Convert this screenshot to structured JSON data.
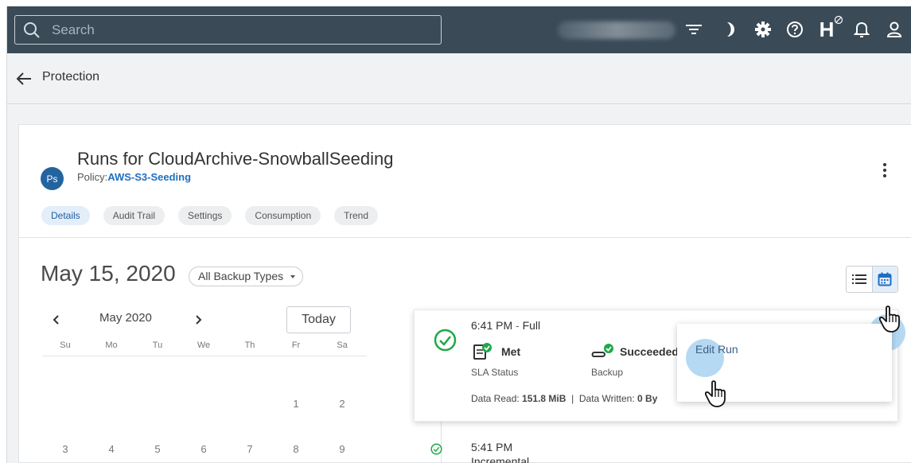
{
  "topbar": {
    "search_placeholder": "Search",
    "icons": [
      "search-icon",
      "filter-icon",
      "moon-icon",
      "gear-icon",
      "help-icon",
      "health-icon",
      "bell-icon",
      "user-icon"
    ]
  },
  "breadcrumb": {
    "label": "Protection"
  },
  "header": {
    "avatar_initials": "Ps",
    "title": "Runs for CloudArchive-SnowballSeeding",
    "policy_label": "Policy:",
    "policy_name": "AWS-S3-Seeding"
  },
  "tabs": [
    {
      "label": "Details",
      "active": true
    },
    {
      "label": "Audit Trail"
    },
    {
      "label": "Settings"
    },
    {
      "label": "Consumption"
    },
    {
      "label": "Trend"
    }
  ],
  "date_title": "May 15, 2020",
  "backup_type_filter": "All Backup Types",
  "calendar": {
    "month_label": "May 2020",
    "today_label": "Today",
    "weekdays": [
      "Su",
      "Mo",
      "Tu",
      "We",
      "Th",
      "Fr",
      "Sa"
    ],
    "rows": [
      [
        "",
        "",
        "",
        "",
        "",
        "1",
        "2"
      ],
      [
        "3",
        "4",
        "5",
        "6",
        "7",
        "8",
        "9"
      ]
    ]
  },
  "runs": [
    {
      "time": "6:41 PM",
      "separator": "-",
      "type": "Full",
      "sla_value": "Met",
      "sla_label": "SLA Status",
      "backup_value": "Succeeded",
      "backup_label": "Backup",
      "data_read_label": "Data Read:",
      "data_read_value": "151.8 MiB",
      "meta_separator": "|",
      "data_written_label": "Data Written:",
      "data_written_value": "0 By"
    },
    {
      "time": "5:41 PM",
      "type": "Incremental"
    }
  ],
  "run_menu": {
    "items": [
      "Edit Run"
    ]
  },
  "colors": {
    "topbar": "#3a4a57",
    "accent": "#1f6fc0",
    "success": "#1fa84a",
    "highlight": "#a8d2f0"
  }
}
